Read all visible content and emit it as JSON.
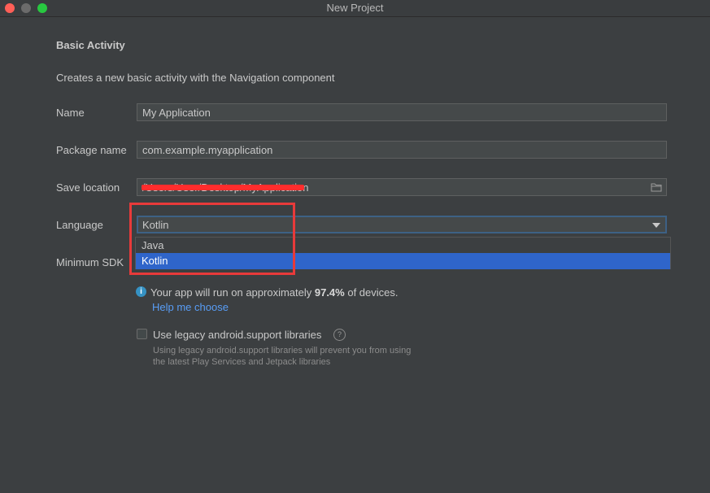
{
  "window": {
    "title": "New Project"
  },
  "form": {
    "heading": "Basic Activity",
    "description": "Creates a new basic activity with the Navigation component",
    "name_label": "Name",
    "name_value": "My Application",
    "package_label": "Package name",
    "package_value": "com.example.myapplication",
    "save_label": "Save location",
    "save_value": "/Users/User/Desktop/MyApplication",
    "language_label": "Language",
    "language_value": "Kotlin",
    "language_options": [
      "Java",
      "Kotlin"
    ],
    "language_selected_index": 1,
    "min_sdk_label": "Minimum SDK"
  },
  "info": {
    "prefix": "Your app will run on approximately ",
    "percent": "97.4%",
    "suffix": " of devices.",
    "help_link": "Help me choose"
  },
  "legacy": {
    "checkbox_label": "Use legacy android.support libraries",
    "checked": false,
    "hint_line1": "Using legacy android.support libraries will prevent you from using",
    "hint_line2": "the latest Play Services and Jetpack libraries"
  },
  "icons": {
    "info": "info-icon",
    "help": "help-icon",
    "folder": "folder-icon",
    "dropdown": "chevron-down-icon"
  },
  "colors": {
    "background": "#3c3f41",
    "selection": "#2f65ca",
    "link": "#589df6",
    "annotation": "#e83a3a"
  }
}
